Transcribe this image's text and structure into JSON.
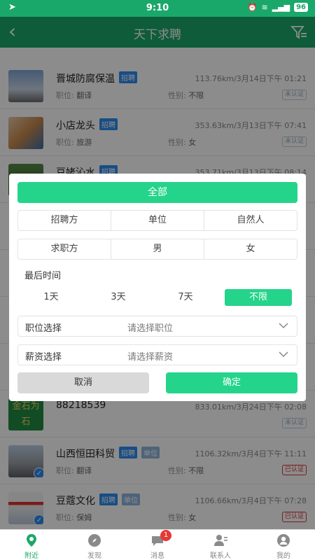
{
  "status": {
    "time": "9:10",
    "battery": "96"
  },
  "header": {
    "title": "天下求聘"
  },
  "list": {
    "items": [
      {
        "name": "晋城防腐保温",
        "tag": "招聘",
        "meta": "113.76km/3月14日下午 01:21",
        "pos_label": "职位:",
        "pos": "翻译",
        "gen_label": "性别:",
        "gen": "不限",
        "cert": "未认证"
      },
      {
        "name": "小店龙头",
        "tag": "招聘",
        "meta": "353.63km/3月13日下午 07:41",
        "pos_label": "职位:",
        "pos": "旅游",
        "gen_label": "性别:",
        "gen": "女",
        "cert": "未认证"
      },
      {
        "name": "豆姥沁水",
        "tag": "招聘",
        "meta": "353.71km/3月13日下午 08:14"
      },
      {
        "name": "88218539",
        "meta": "833.01km/3月24日下午 02:08",
        "cert": "未认证",
        "thumb_text": "金石为石"
      },
      {
        "name": "山西恒田科贸",
        "tag": "招聘",
        "tag2": "单位",
        "meta": "1106.32km/3月4日下午 11:11",
        "pos_label": "职位:",
        "pos": "翻译",
        "gen_label": "性别:",
        "gen": "不限",
        "cert": "已认证"
      },
      {
        "name": "豆蔻文化",
        "tag": "招聘",
        "tag2": "单位",
        "meta": "1106.66km/3月4日下午 07:28",
        "pos_label": "职位:",
        "pos": "保姆",
        "gen_label": "性别:",
        "gen": "女",
        "cert": "已认证"
      }
    ]
  },
  "filter": {
    "all_label": "全部",
    "recruit_row": [
      "招聘方",
      "单位",
      "自然人"
    ],
    "seeker_row": [
      "求职方",
      "男",
      "女"
    ],
    "time_label": "最后时间",
    "time_options": [
      "1天",
      "3天",
      "7天",
      "不限"
    ],
    "position": {
      "label": "职位选择",
      "placeholder": "请选择职位"
    },
    "salary": {
      "label": "薪资选择",
      "placeholder": "请选择薪资"
    },
    "cancel": "取消",
    "confirm": "确定"
  },
  "tabs": [
    {
      "label": "附近"
    },
    {
      "label": "发现"
    },
    {
      "label": "消息",
      "badge": "1"
    },
    {
      "label": "联系人"
    },
    {
      "label": "我的"
    }
  ],
  "colors": {
    "primary": "#1aa86a",
    "accent": "#24d48a",
    "tag": "#2d8cf0",
    "verified": "#d33333"
  }
}
